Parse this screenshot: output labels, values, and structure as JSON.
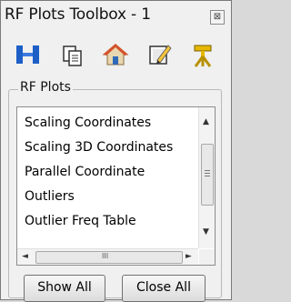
{
  "window": {
    "title": "RF Plots Toolbox - 1",
    "close_glyph": "⊠"
  },
  "toolbar": {
    "tools": [
      {
        "icon": "blue-bars-icon"
      },
      {
        "icon": "copy-icon"
      },
      {
        "icon": "home-icon"
      },
      {
        "icon": "edit-note-icon"
      },
      {
        "icon": "tripod-icon"
      }
    ]
  },
  "rf_plots": {
    "group_label": "RF Plots",
    "items": [
      "Scaling Coordinates",
      "Scaling 3D Coordinates",
      "Parallel Coordinate",
      "Outliers",
      "Outlier Freq Table"
    ],
    "scroll_glyphs": {
      "up": "▲",
      "down": "▼",
      "left": "◄",
      "right": "►",
      "grip": "III"
    }
  },
  "buttons": {
    "show_all": "Show All",
    "close_all": "Close All"
  }
}
